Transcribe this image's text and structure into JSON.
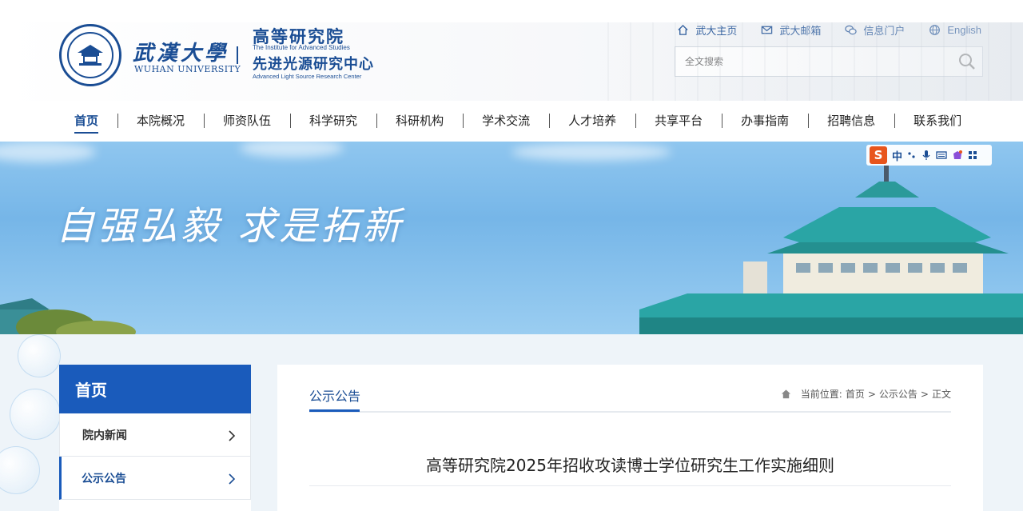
{
  "header": {
    "university_cn": "武漢大學",
    "university_en": "WUHAN UNIVERSITY",
    "institute_cn": "高等研究院",
    "institute_en": "The Institute for Advanced Studies",
    "center_cn": "先进光源研究中心",
    "center_en": "Advanced Light Source Research Center"
  },
  "quick_links": [
    {
      "label": "武大主页",
      "icon": "home-icon"
    },
    {
      "label": "武大邮箱",
      "icon": "mail-icon"
    },
    {
      "label": "信息门户",
      "icon": "chat-icon"
    },
    {
      "label": "English",
      "icon": "globe-icon"
    }
  ],
  "search": {
    "placeholder": "全文搜索"
  },
  "nav": {
    "items": [
      "首页",
      "本院概况",
      "师资队伍",
      "科学研究",
      "科研机构",
      "学术交流",
      "人才培养",
      "共享平台",
      "办事指南",
      "招聘信息",
      "联系我们"
    ],
    "active": "首页"
  },
  "banner": {
    "slogan": "自强弘毅 求是拓新",
    "ime": {
      "logo": "S",
      "mode": "中"
    }
  },
  "sidebar": {
    "title": "首页",
    "items": [
      {
        "label": "院内新闻",
        "active": false
      },
      {
        "label": "公示公告",
        "active": true
      }
    ]
  },
  "main": {
    "tab": "公示公告",
    "breadcrumb": {
      "prefix": "当前位置:",
      "items": [
        "首页",
        "公示公告",
        "正文"
      ],
      "separator": ">"
    },
    "article_title": "高等研究院2025年招收攻读博士学位研究生工作实施细则"
  },
  "colors": {
    "brand_blue": "#1a4d94",
    "sidebar_head": "#1a5bbb",
    "banner_sky": "#76b6e8"
  }
}
